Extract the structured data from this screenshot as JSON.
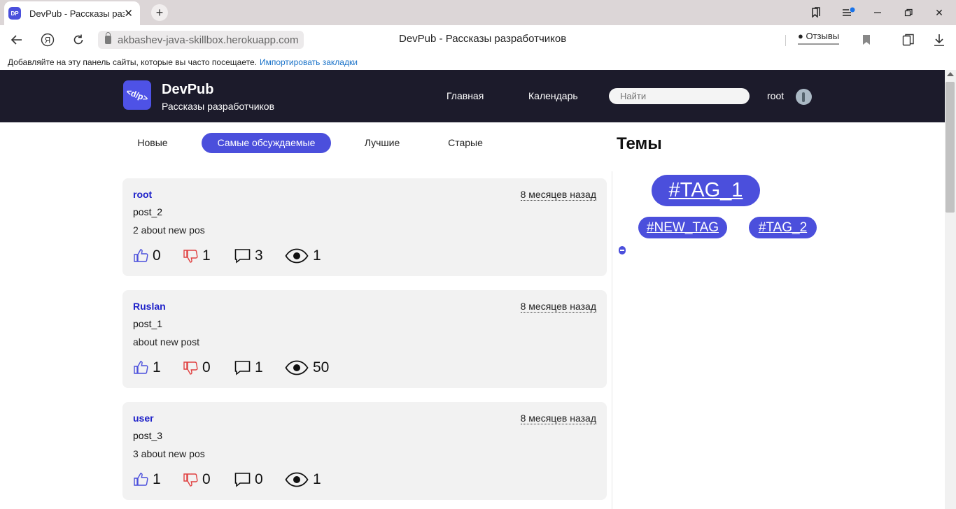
{
  "browser": {
    "tab_title": "DevPub - Рассказы разработчиков",
    "favicon_text": "DP",
    "url": "akbashev-java-skillbox.herokuapp.com",
    "page_title": "DevPub - Рассказы разработчиков",
    "reviews_label": "Отзывы",
    "bookmarks_hint": "Добавляйте на эту панель сайты, которые вы часто посещаете.",
    "bookmarks_import": "Импортировать закладки"
  },
  "header": {
    "logo_text": "<d/p>",
    "brand": "DevPub",
    "tagline": "Рассказы разработчиков",
    "nav": [
      "Главная",
      "Календарь"
    ],
    "search_placeholder": "Найти",
    "user": "root"
  },
  "filters": [
    {
      "label": "Новые",
      "active": false
    },
    {
      "label": "Самые обсуждаемые",
      "active": true
    },
    {
      "label": "Лучшие",
      "active": false
    },
    {
      "label": "Старые",
      "active": false
    }
  ],
  "posts": [
    {
      "author": "root",
      "date": "8 месяцев назад",
      "title": "post_2",
      "description": "2 about new pos",
      "likes": "0",
      "dislikes": "1",
      "comments": "3",
      "views": "1"
    },
    {
      "author": "Ruslan",
      "date": "8 месяцев назад",
      "title": "post_1",
      "description": "about new post",
      "likes": "1",
      "dislikes": "0",
      "comments": "1",
      "views": "50"
    },
    {
      "author": "user",
      "date": "8 месяцев назад",
      "title": "post_3",
      "description": "3 about new pos",
      "likes": "1",
      "dislikes": "0",
      "comments": "0",
      "views": "1"
    }
  ],
  "sidebar": {
    "title": "Темы",
    "tags": [
      "#TAG_1",
      "#NEW_TAG",
      "#TAG_2"
    ]
  },
  "colors": {
    "accent": "#4b4fdc",
    "header_bg": "#1c1b2b",
    "author": "#1f22c9",
    "dislike": "#e04040"
  }
}
